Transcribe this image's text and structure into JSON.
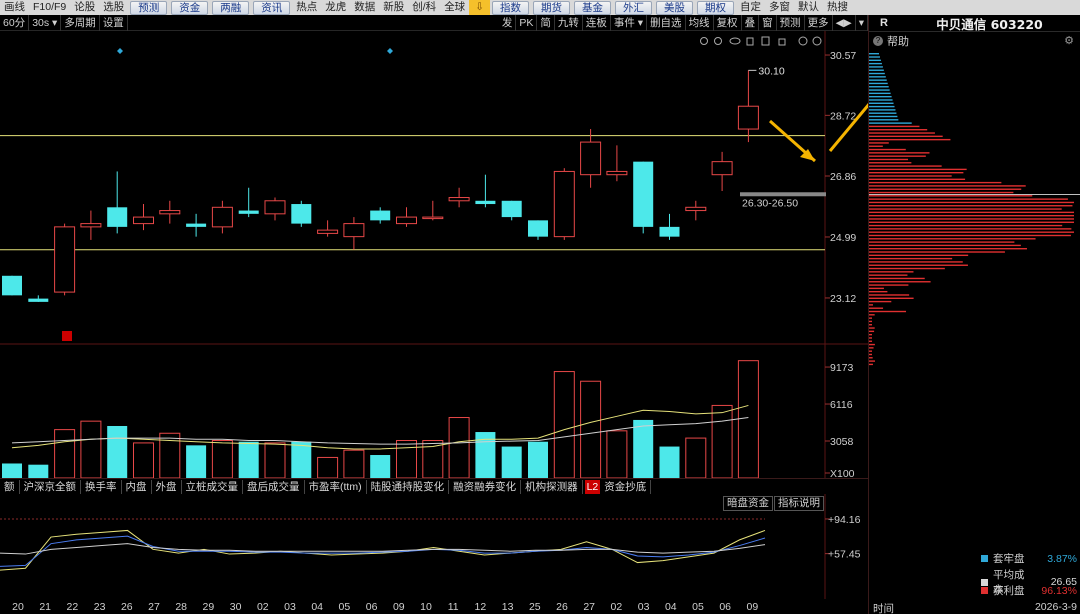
{
  "menubar": {
    "items": [
      {
        "label": "画线",
        "style": "plain"
      },
      {
        "label": "F10/F9",
        "style": "plain"
      },
      {
        "label": "论股",
        "style": "plain"
      },
      {
        "label": "选股",
        "style": "plain"
      },
      {
        "label": "预测",
        "style": "btn"
      },
      {
        "label": "资金",
        "style": "btn"
      },
      {
        "label": "两融",
        "style": "btn"
      },
      {
        "label": "资讯",
        "style": "btn"
      },
      {
        "label": "热点",
        "style": "plain"
      },
      {
        "label": "龙虎",
        "style": "plain"
      },
      {
        "label": "数据",
        "style": "plain"
      },
      {
        "label": "新股",
        "style": "plain"
      },
      {
        "label": "创/科",
        "style": "plain"
      },
      {
        "label": "全球",
        "style": "plain"
      },
      {
        "label": "⇩",
        "style": "highlight"
      },
      {
        "label": "指数",
        "style": "btn"
      },
      {
        "label": "期货",
        "style": "btn"
      },
      {
        "label": "基金",
        "style": "btn"
      },
      {
        "label": "外汇",
        "style": "btn"
      },
      {
        "label": "美股",
        "style": "btn"
      },
      {
        "label": "期权",
        "style": "btn"
      },
      {
        "label": "自定",
        "style": "plain"
      },
      {
        "label": "多窗",
        "style": "plain"
      },
      {
        "label": "默认",
        "style": "plain"
      },
      {
        "label": "热搜",
        "style": "plain"
      }
    ]
  },
  "toolbar": {
    "left": [
      "60分",
      "30s ▾",
      "多周期",
      "设置"
    ],
    "right": [
      "发",
      "PK",
      "简",
      "九转",
      "连板",
      "事件 ▾",
      "删自选",
      "均线",
      "复权",
      "叠",
      "窗",
      "预测",
      "更多",
      "◀▶",
      "▾"
    ]
  },
  "right_panel": {
    "flag": "R",
    "stock_name": "中贝通信 603220",
    "help": "帮助",
    "legend": [
      {
        "label": "套牢盘",
        "value": "3.87%",
        "color": "#2fa8d8",
        "value_color": "#2fa8d8"
      },
      {
        "label": "平均成本",
        "value": "26.65",
        "color": "#d8d8d8",
        "value_color": "#d8d8d8"
      },
      {
        "label": "获利盘",
        "value": "96.13%",
        "color": "#e03030",
        "value_color": "#e03030"
      }
    ],
    "bottom_left": "时间",
    "bottom_right": "2026-3-9"
  },
  "indicator_tabs": [
    "额",
    "沪深京全额",
    "换手率",
    "内盘",
    "外盘",
    "立桩成交量",
    "盘后成交量",
    "市盈率(ttm)",
    "陆股通持股变化",
    "融资融券变化",
    "机构探测器",
    "L2",
    "资金抄底"
  ],
  "hidden_funds_btn": "暗盘资金",
  "indicator_help_btn": "指标说明",
  "chart_data": {
    "type": "candlestick",
    "x_labels": [
      "20",
      "21",
      "22",
      "23",
      "26",
      "27",
      "28",
      "29",
      "30",
      "02",
      "03",
      "04",
      "05",
      "06",
      "09",
      "10",
      "11",
      "12",
      "13",
      "25",
      "26",
      "27",
      "02",
      "03",
      "04",
      "05",
      "06",
      "09"
    ],
    "candles": [
      {
        "o": 23.8,
        "c": 23.2,
        "h": 23.8,
        "l": 23.2
      },
      {
        "o": 23.1,
        "c": 23.0,
        "h": 23.2,
        "l": 23.0
      },
      {
        "o": 23.3,
        "c": 25.3,
        "h": 25.4,
        "l": 23.2
      },
      {
        "o": 25.3,
        "c": 25.4,
        "h": 25.8,
        "l": 24.9
      },
      {
        "o": 25.9,
        "c": 25.3,
        "h": 27.0,
        "l": 25.1
      },
      {
        "o": 25.4,
        "c": 25.6,
        "h": 26.0,
        "l": 25.2
      },
      {
        "o": 25.7,
        "c": 25.8,
        "h": 26.1,
        "l": 25.4
      },
      {
        "o": 25.4,
        "c": 25.3,
        "h": 25.7,
        "l": 25.0
      },
      {
        "o": 25.3,
        "c": 25.9,
        "h": 26.1,
        "l": 25.1
      },
      {
        "o": 25.8,
        "c": 25.7,
        "h": 26.5,
        "l": 25.6
      },
      {
        "o": 25.7,
        "c": 26.1,
        "h": 26.2,
        "l": 25.5
      },
      {
        "o": 26.0,
        "c": 25.4,
        "h": 26.1,
        "l": 25.3
      },
      {
        "o": 25.1,
        "c": 25.2,
        "h": 25.5,
        "l": 25.0
      },
      {
        "o": 25.0,
        "c": 25.4,
        "h": 25.6,
        "l": 24.6
      },
      {
        "o": 25.8,
        "c": 25.5,
        "h": 25.9,
        "l": 25.4
      },
      {
        "o": 25.4,
        "c": 25.6,
        "h": 25.9,
        "l": 25.3
      },
      {
        "o": 25.6,
        "c": 25.6,
        "h": 26.1,
        "l": 25.5
      },
      {
        "o": 26.1,
        "c": 26.2,
        "h": 26.5,
        "l": 25.9
      },
      {
        "o": 26.1,
        "c": 26.0,
        "h": 26.9,
        "l": 25.9
      },
      {
        "o": 26.1,
        "c": 25.6,
        "h": 26.1,
        "l": 25.5
      },
      {
        "o": 25.5,
        "c": 25.0,
        "h": 25.5,
        "l": 24.9
      },
      {
        "o": 25.0,
        "c": 27.0,
        "h": 27.1,
        "l": 24.9
      },
      {
        "o": 26.9,
        "c": 27.9,
        "h": 28.3,
        "l": 26.5
      },
      {
        "o": 26.9,
        "c": 27.0,
        "h": 27.8,
        "l": 26.7
      },
      {
        "o": 27.3,
        "c": 25.3,
        "h": 27.3,
        "l": 25.1
      },
      {
        "o": 25.3,
        "c": 25.0,
        "h": 25.7,
        "l": 24.9
      },
      {
        "o": 25.8,
        "c": 25.9,
        "h": 26.1,
        "l": 25.5
      },
      {
        "o": 26.9,
        "c": 27.3,
        "h": 27.6,
        "l": 26.4
      },
      {
        "o": 28.3,
        "c": 29.0,
        "h": 30.1,
        "l": 27.9
      }
    ],
    "y_ticks": [
      "30.57",
      "28.72",
      "26.86",
      "24.99",
      "23.12"
    ],
    "ylim": [
      21.8,
      31.0
    ],
    "high_label": "30.10",
    "range_label": "26.30-26.50",
    "hlines": [
      28.1,
      24.6
    ],
    "volume": {
      "values": [
        1200,
        1100,
        4000,
        4700,
        4300,
        2900,
        3700,
        2700,
        3100,
        3000,
        2900,
        3000,
        1700,
        2300,
        1900,
        3100,
        3100,
        5000,
        3800,
        2600,
        3000,
        8800,
        8000,
        3900,
        4800,
        2600,
        3300,
        6000,
        9700
      ],
      "ticks": [
        "9173",
        "6116",
        "3058",
        "X100"
      ],
      "ylim": [
        0,
        10500
      ]
    },
    "indicator": {
      "ticks": [
        "+94.16",
        "+57.45"
      ],
      "ylim": [
        20,
        110
      ],
      "line1": [
        40,
        42,
        75,
        78,
        80,
        82,
        62,
        58,
        62,
        57,
        58,
        60,
        58,
        56,
        57,
        58,
        60,
        64,
        60,
        56,
        58,
        60,
        62,
        70,
        62,
        48,
        50,
        54,
        58,
        72,
        82
      ],
      "line2": [
        44,
        45,
        68,
        72,
        74,
        76,
        65,
        60,
        60,
        60,
        59,
        59,
        58,
        58,
        58,
        59,
        60,
        62,
        61,
        58,
        58,
        60,
        61,
        64,
        62,
        55,
        54,
        56,
        59,
        66,
        74
      ],
      "line3": [
        58,
        57,
        62,
        64,
        66,
        68,
        64,
        62,
        61,
        61,
        60,
        60,
        60,
        60,
        60,
        60,
        61,
        62,
        62,
        61,
        60,
        61,
        61,
        62,
        62,
        59,
        58,
        59,
        60,
        63,
        67
      ]
    }
  }
}
